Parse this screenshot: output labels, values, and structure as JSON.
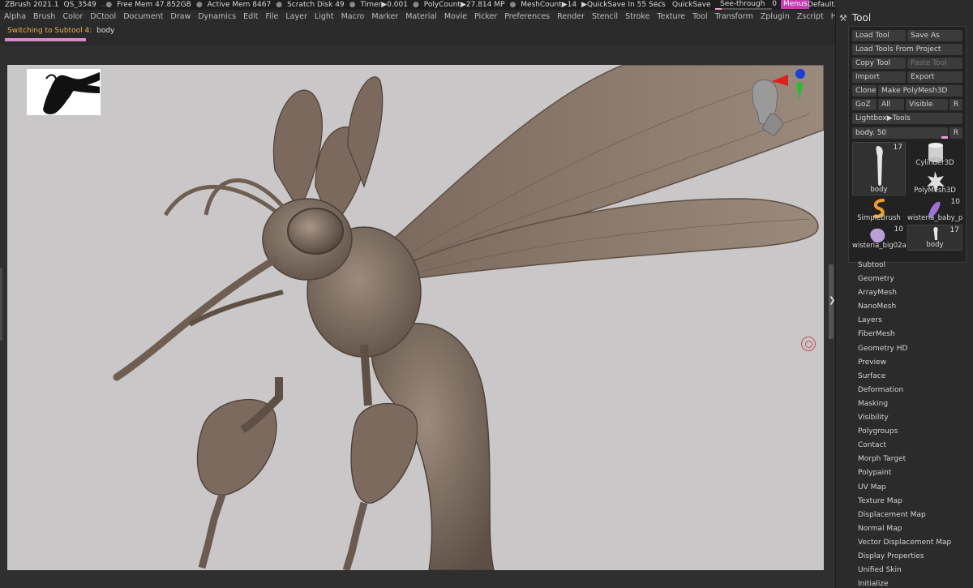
{
  "titlebar": {
    "app": "ZBrush 2021.1",
    "project": "QS_3549",
    "free_mem": "Free Mem 47.852GB",
    "active_mem": "Active Mem 8467",
    "scratch_disk": "Scratch Disk 49",
    "timer": "Timer▶0.001",
    "polycount": "PolyCount▶27.814 MP",
    "meshcount": "MeshCount▶14",
    "quicksave_in": "▶QuickSave In 55 Secs",
    "ac": "AC",
    "quicksave": "QuickSave",
    "see_through_label": "See-through",
    "see_through_value": "0",
    "menus": "Menus",
    "default_zscript": "DefaultZScript"
  },
  "menubar": [
    "Alpha",
    "Brush",
    "Color",
    "DCtool",
    "Document",
    "Draw",
    "Dynamics",
    "Edit",
    "File",
    "Layer",
    "Light",
    "Macro",
    "Marker",
    "Material",
    "Movie",
    "Picker",
    "Preferences",
    "Render",
    "Stencil",
    "Stroke",
    "Texture",
    "Tool",
    "Transform",
    "Zplugin",
    "Zscript",
    "Help"
  ],
  "status": {
    "prefix": "Switching to Subtool 4:",
    "name": "body"
  },
  "tool_panel": {
    "title": "Tool",
    "buttons": {
      "load_tool": "Load Tool",
      "save_as": "Save As",
      "load_from_project": "Load Tools From Project",
      "copy_tool": "Copy Tool",
      "paste_tool": "Paste Tool",
      "import": "Import",
      "export": "Export",
      "clone": "Clone",
      "make_polymesh": "Make PolyMesh3D",
      "goz": "GoZ",
      "all": "All",
      "visible": "Visible",
      "r": "R",
      "lightbox": "Lightbox▶Tools",
      "r2": "R"
    },
    "slider_label": "body. 50",
    "tools": [
      {
        "label": "body",
        "count": "17"
      },
      {
        "label": "Cylinder3D",
        "count": ""
      },
      {
        "label": "PolyMesh3D",
        "count": ""
      },
      {
        "label": "SimpleBrush",
        "count": ""
      },
      {
        "label": "wisteria_baby_pe",
        "count": "10"
      },
      {
        "label": "wisteria_big02a",
        "count": "10"
      },
      {
        "label": "body",
        "count": "17"
      }
    ],
    "menu": [
      "Subtool",
      "Geometry",
      "ArrayMesh",
      "NanoMesh",
      "Layers",
      "FiberMesh",
      "Geometry HD",
      "Preview",
      "Surface",
      "Deformation",
      "Masking",
      "Visibility",
      "Polygroups",
      "Contact",
      "Morph Target",
      "Polypaint",
      "UV Map",
      "Texture Map",
      "Displacement Map",
      "Normal Map",
      "Vector Displacement Map",
      "Display Properties",
      "Unified Skin",
      "Initialize"
    ]
  },
  "colors": {
    "accent_pink": "#e89ad2",
    "menus_magenta": "#c33cb0",
    "status_orange": "#e8b050",
    "canvas_bg": "#c9c7c7",
    "sculpt_clay": "#857466"
  }
}
